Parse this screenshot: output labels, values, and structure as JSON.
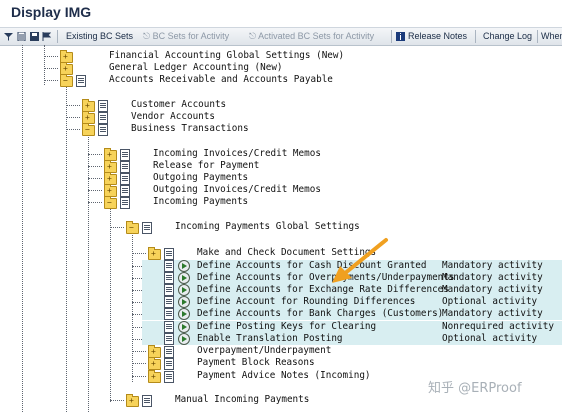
{
  "window": {
    "title": "Display IMG"
  },
  "toolbar": {
    "existing_bc_sets": "Existing BC Sets",
    "bc_sets_for_activity": "BC Sets for Activity",
    "activated_bc_sets_for_activity": "Activated BC Sets for Activity",
    "release_notes": "Release Notes",
    "change_log": "Change Log",
    "where_used": "When"
  },
  "tree": {
    "financial_accounting_global_settings": "Financial Accounting Global Settings (New)",
    "general_ledger_accounting": "General Ledger Accounting (New)",
    "accounts_receivable_payable": "Accounts Receivable and Accounts Payable",
    "customer_accounts": "Customer Accounts",
    "vendor_accounts": "Vendor Accounts",
    "business_transactions": "Business Transactions",
    "incoming_invoices": "Incoming Invoices/Credit Memos",
    "release_for_payment": "Release for Payment",
    "outgoing_payments": "Outgoing Payments",
    "outgoing_invoices": "Outgoing Invoices/Credit Memos",
    "incoming_payments": "Incoming Payments",
    "incoming_payments_global": "Incoming Payments Global Settings",
    "make_check_doc_settings": "Make and Check Document Settings",
    "cash_discount_granted": "Define Accounts for Cash Discount Granted",
    "overpayments_underpayments": "Define Accounts for Overpayments/Underpayments",
    "exchange_rate_differences": "Define Accounts for Exchange Rate Differences",
    "rounding_differences": "Define Account for Rounding Differences",
    "bank_charges": "Define Accounts for Bank Charges (Customers)",
    "posting_keys_clearing": "Define Posting Keys for Clearing",
    "enable_translation_posting": "Enable Translation Posting",
    "overpayment_underpayment": "Overpayment/Underpayment",
    "payment_block_reasons": "Payment Block Reasons",
    "payment_advice_notes": "Payment Advice Notes (Incoming)",
    "manual_incoming_payments": "Manual Incoming Payments"
  },
  "statuses": {
    "cash_discount_granted": "Mandatory activity",
    "overpayments_underpayments": "Mandatory activity",
    "exchange_rate_differences": "Mandatory activity",
    "rounding_differences": "Optional activity",
    "bank_charges": "Mandatory activity",
    "posting_keys_clearing": "Nonrequired activity",
    "enable_translation_posting": "Optional activity"
  },
  "watermark": "知乎 @ERProof",
  "colors": {
    "highlight": "#d8eef1",
    "folder": "#f7d35a",
    "arrow": "#f0a020"
  }
}
